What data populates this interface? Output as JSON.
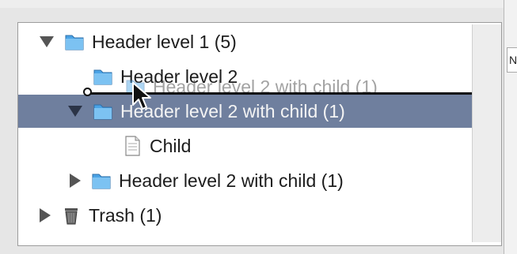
{
  "outline": {
    "rows": [
      {
        "label": "Header level 1 (5)",
        "icon": "folder-icon",
        "disclosure": "expanded"
      },
      {
        "label": "Header level 2",
        "icon": "folder-icon",
        "disclosure": "none"
      },
      {
        "label": "Header level 2 with child (1)",
        "icon": "folder-icon",
        "disclosure": "expanded",
        "selected": true
      },
      {
        "label": "Child",
        "icon": "document-icon",
        "disclosure": "none"
      },
      {
        "label": "Header level 2 with child (1)",
        "icon": "folder-icon",
        "disclosure": "collapsed"
      },
      {
        "label": "Trash (1)",
        "icon": "trash-icon",
        "disclosure": "collapsed"
      }
    ],
    "drag_ghost_label": "Header level 2 with child (1)"
  },
  "side_panel": {
    "cell_text": "N"
  },
  "colors": {
    "selection": "#6f7f9e",
    "folder": "#4aa3e6",
    "drop_indicator": "#111111"
  }
}
